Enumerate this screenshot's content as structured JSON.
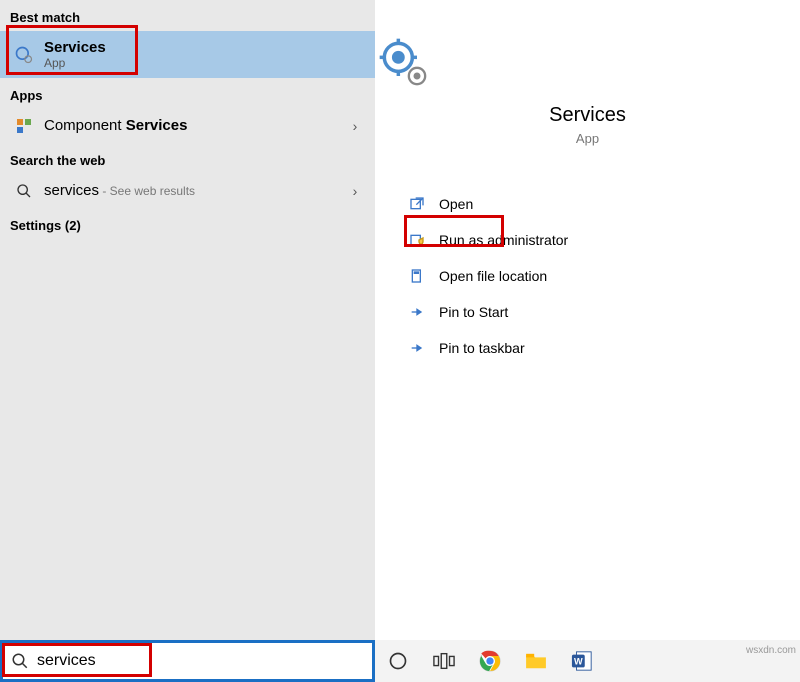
{
  "left": {
    "header_best": "Best match",
    "best": {
      "title": "Services",
      "sub": "App"
    },
    "header_apps": "Apps",
    "app_item": {
      "prefix": "Component ",
      "bold": "Services"
    },
    "header_web": "Search the web",
    "web_item": {
      "term": "services",
      "suffix": " - See web results"
    },
    "header_settings": "Settings (2)"
  },
  "right": {
    "title": "Services",
    "sub": "App",
    "actions": {
      "open": "Open",
      "admin": "Run as administrator",
      "loc": "Open file location",
      "pinstart": "Pin to Start",
      "pintask": "Pin to taskbar"
    }
  },
  "search": {
    "value": "services"
  },
  "watermark": "wsxdn.com"
}
